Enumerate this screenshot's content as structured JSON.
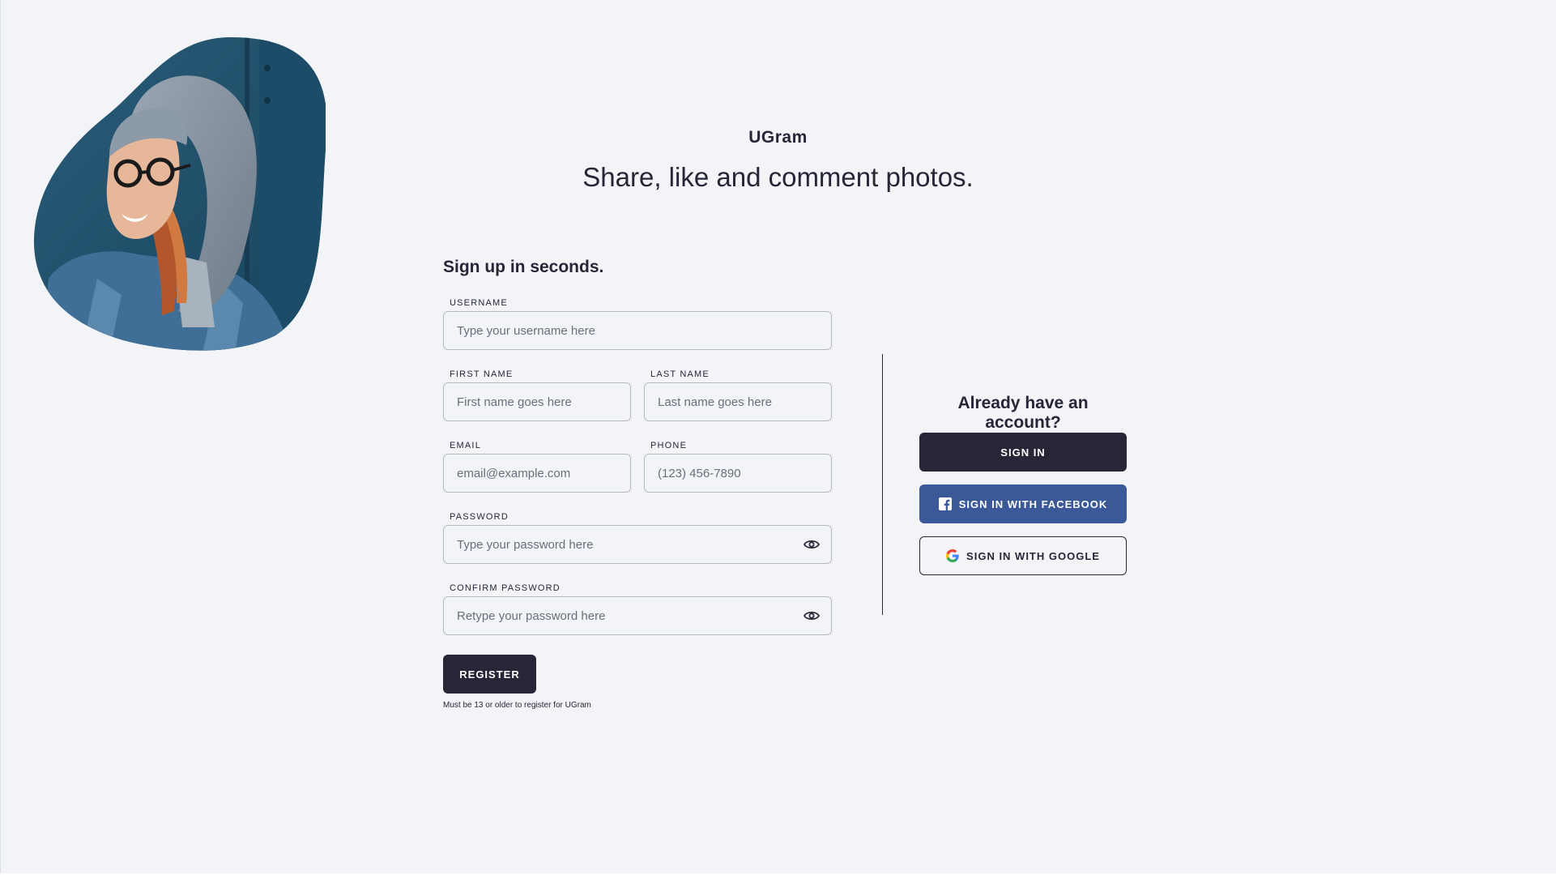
{
  "brand": {
    "name": "UGram",
    "tagline": "Share, like and comment photos."
  },
  "signup": {
    "title": "Sign up in seconds.",
    "username": {
      "label": "USERNAME",
      "placeholder": "Type your username here",
      "value": ""
    },
    "first_name": {
      "label": "FIRST NAME",
      "placeholder": "First name goes here",
      "value": ""
    },
    "last_name": {
      "label": "LAST NAME",
      "placeholder": "Last name goes here",
      "value": ""
    },
    "email": {
      "label": "EMAIL",
      "placeholder": "email@example.com",
      "value": ""
    },
    "phone": {
      "label": "PHONE",
      "placeholder": "(123) 456-7890",
      "value": ""
    },
    "password": {
      "label": "PASSWORD",
      "placeholder": "Type your password here",
      "value": "",
      "icon": "eye-icon"
    },
    "confirm_password": {
      "label": "CONFIRM PASSWORD",
      "placeholder": "Retype your password here",
      "value": "",
      "icon": "eye-icon"
    },
    "register_label": "REGISTER",
    "age_note": "Must be 13 or older to register for UGram"
  },
  "signin": {
    "title": "Already have an account?",
    "signin_label": "SIGN IN",
    "facebook_label": "SIGN IN WITH FACEBOOK",
    "facebook_icon": "facebook-icon",
    "google_label": "SIGN IN WITH GOOGLE",
    "google_icon": "google-icon"
  },
  "colors": {
    "background": "#f3f4f8",
    "primary": "#262637",
    "facebook": "#3b5998",
    "field_border": "#b6b8c3",
    "placeholder": "#6b6e7c"
  }
}
